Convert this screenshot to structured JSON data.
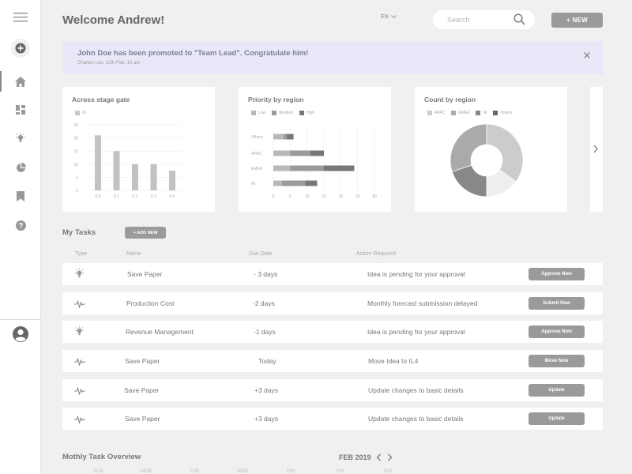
{
  "header": {
    "welcome": "Welcome Andrew!",
    "language": "EN",
    "search_placeholder": "Search",
    "new_label": "+ NEW"
  },
  "banner": {
    "title": "John Doe has been promoted to \"Team Lead\". Congratulate him!",
    "subtitle": "Charles Lee, 12th Feb, 10 am"
  },
  "sidebar": {
    "icons": [
      "menu-icon",
      "add-icon",
      "home-icon",
      "dashboard-icon",
      "idea-icon",
      "pie-chart-icon",
      "bookmark-icon",
      "help-icon",
      "user-avatar-icon"
    ]
  },
  "chart_data": [
    {
      "type": "bar",
      "title": "Across stage gate",
      "legend": [
        "ID"
      ],
      "categories": [
        "0.0",
        "0.1",
        "0.2",
        "0.3",
        "0.4"
      ],
      "values": [
        21,
        15,
        10,
        10,
        7.5
      ],
      "yticks": [
        "0",
        "5",
        "10",
        "15",
        "20",
        "25"
      ],
      "ylim": [
        0,
        25
      ]
    },
    {
      "type": "bar",
      "orientation": "horizontal",
      "stacked": true,
      "title": "Priority by region",
      "categories": [
        "Others",
        "APAC",
        "EMEA",
        "NI"
      ],
      "xticks": [
        "0",
        "5",
        "10",
        "15",
        "20",
        "25",
        "30"
      ],
      "xlim": [
        0,
        30
      ],
      "series": [
        {
          "name": "Low",
          "color": "#b8b8b8",
          "values": [
            3,
            5,
            5,
            2.5
          ]
        },
        {
          "name": "Medium",
          "color": "#9a9a9a",
          "values": [
            1,
            6,
            10,
            7
          ]
        },
        {
          "name": "High",
          "color": "#777777",
          "values": [
            2,
            4,
            9,
            3.5
          ]
        }
      ]
    },
    {
      "type": "pie",
      "donut": true,
      "title": "Count by region",
      "labels": [
        "APAC",
        "EMEA",
        "NI",
        "Others"
      ],
      "values": [
        35,
        15,
        20,
        30
      ],
      "colors": [
        "#cccccc",
        "#eeeeee",
        "#888888",
        "#aaaaaa"
      ]
    }
  ],
  "tasks": {
    "title": "My Tasks",
    "add_new": "+ ADD NEW",
    "headers": {
      "type": "Type",
      "name": "Name",
      "due": "Due Date",
      "action": "Action Required"
    },
    "rows": [
      {
        "icon": "idea-icon",
        "name": "Save Paper",
        "due": "- 3 days",
        "action": "Idea is pending for your approval",
        "button": "Approve Now"
      },
      {
        "icon": "pulse-icon",
        "name": "Production Cost",
        "due": "-2 days",
        "action": "Monthly forecast submission delayed",
        "button": "Submit Now"
      },
      {
        "icon": "idea-icon",
        "name": "Revenue Management",
        "due": "-1 days",
        "action": "Idea is pending for your approval",
        "button": "Approve Now"
      },
      {
        "icon": "pulse-icon",
        "name": "Save Paper",
        "due": "Today",
        "action": "Move Idea to IL4",
        "button": "Move Now"
      },
      {
        "icon": "pulse-icon",
        "name": "Save Paper",
        "due": "+3 days",
        "action": "Update changes to basic details",
        "button": "Update"
      },
      {
        "icon": "pulse-icon",
        "name": "Save Paper",
        "due": "+3 days",
        "action": "Update changes to basic details",
        "button": "Update"
      }
    ]
  },
  "monthly": {
    "title": "Mothly Task Overview",
    "month": "FEB 2019",
    "days": [
      "SUN",
      "MON",
      "TUE",
      "WED",
      "THU",
      "FRI",
      "SAT"
    ]
  }
}
